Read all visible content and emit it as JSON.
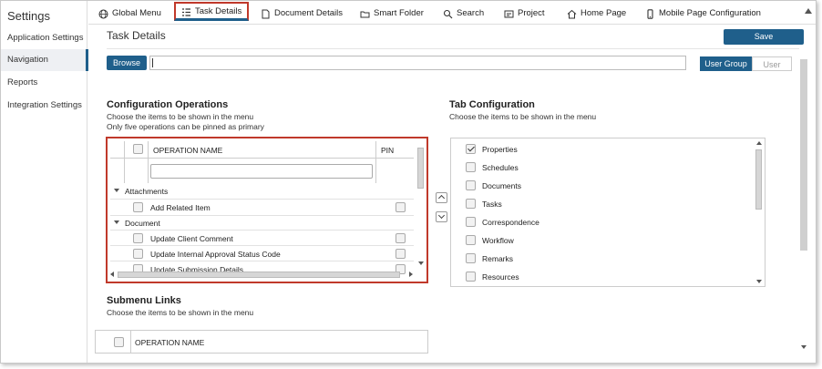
{
  "sidebar": {
    "title": "Settings",
    "items": [
      {
        "label": "Application Settings"
      },
      {
        "label": "Navigation"
      },
      {
        "label": "Reports"
      },
      {
        "label": "Integration Settings"
      }
    ]
  },
  "topnav": {
    "tabs": [
      {
        "label": "Global Menu",
        "icon": "globe-icon"
      },
      {
        "label": "Task Details",
        "icon": "list-icon"
      },
      {
        "label": "Document Details",
        "icon": "document-icon"
      },
      {
        "label": "Smart Folder",
        "icon": "folder-icon"
      },
      {
        "label": "Search",
        "icon": "search-icon"
      },
      {
        "label": "Project",
        "icon": "project-icon"
      },
      {
        "label": "Home Page",
        "icon": "home-icon"
      },
      {
        "label": "Mobile Page Configuration",
        "icon": "mobile-icon"
      }
    ],
    "active": "Task Details"
  },
  "main": {
    "title": "Task Details",
    "save_label": "Save",
    "browse_label": "Browse",
    "path_value": "",
    "toggle": {
      "user_group": "User Group",
      "user": "User"
    }
  },
  "config_ops": {
    "heading": "Configuration Operations",
    "desc1": "Choose the items to be shown in the menu",
    "desc2": "Only five operations can be pinned as primary",
    "col_name": "OPERATION NAME",
    "col_pin": "PIN",
    "filter_value": "",
    "groups": [
      {
        "name": "Attachments",
        "items": [
          "Add Related Item"
        ]
      },
      {
        "name": "Document",
        "items": [
          "Update Client Comment",
          "Update Internal Approval Status Code",
          "Update Submission Details"
        ]
      }
    ]
  },
  "tab_config": {
    "heading": "Tab Configuration",
    "desc": "Choose the items to be shown in the menu",
    "items": [
      {
        "label": "Properties",
        "checked": true
      },
      {
        "label": "Schedules",
        "checked": false
      },
      {
        "label": "Documents",
        "checked": false
      },
      {
        "label": "Tasks",
        "checked": false
      },
      {
        "label": "Correspondence",
        "checked": false
      },
      {
        "label": "Workflow",
        "checked": false
      },
      {
        "label": "Remarks",
        "checked": false
      },
      {
        "label": "Resources",
        "checked": false
      }
    ]
  },
  "submenu": {
    "heading": "Submenu Links",
    "desc": "Choose the items to be shown in the menu",
    "col_name": "OPERATION NAME"
  },
  "colors": {
    "accent": "#1f5f8b",
    "highlight": "#c0392b"
  }
}
